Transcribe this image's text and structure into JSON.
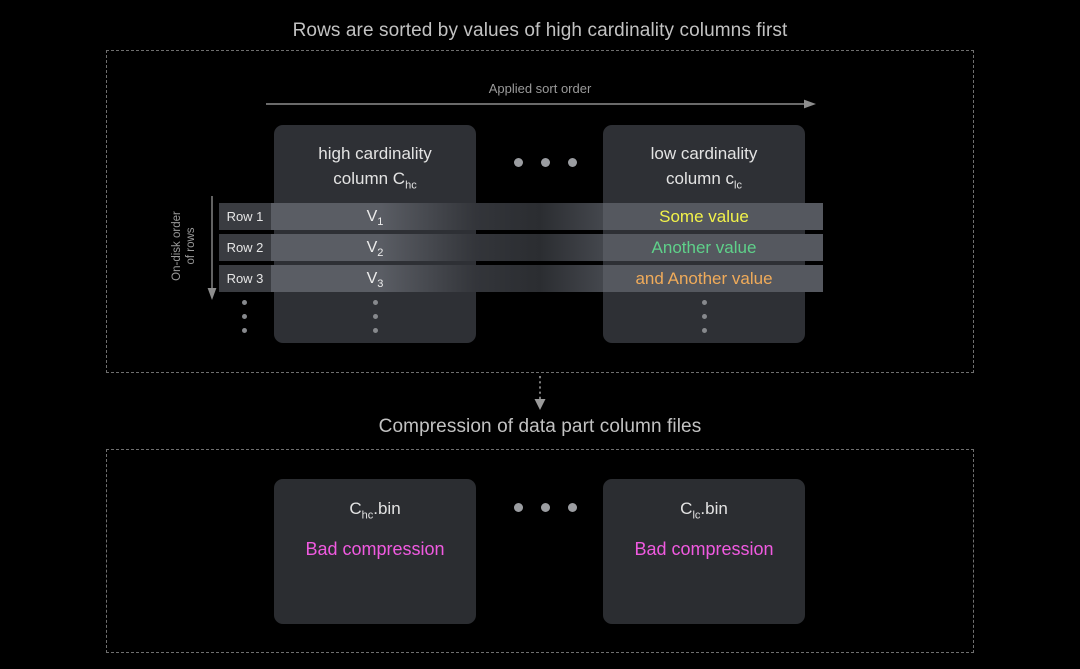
{
  "titles": {
    "top": "Rows are sorted by values of high cardinality columns first",
    "middle": "Compression of data part column files"
  },
  "sort_order": {
    "label": "Applied sort order",
    "direction": "left-to-right"
  },
  "on_disk_order": {
    "label": "On-disk order\nof rows",
    "direction": "top-to-bottom"
  },
  "columns": [
    {
      "id": "hc",
      "head_line1": "high cardinality",
      "head_line2": "column C",
      "head_sub": "hc"
    },
    {
      "id": "lc",
      "head_line1": "low cardinality",
      "head_line2": "column c",
      "head_sub": "lc"
    }
  ],
  "rows": [
    {
      "label": "Row 1",
      "hc_value": "V",
      "hc_sub": "1",
      "lc_value": "Some value",
      "lc_color": "#f3f34a"
    },
    {
      "label": "Row 2",
      "hc_value": "V",
      "hc_sub": "2",
      "lc_value": "Another value",
      "lc_color": "#5fd18a"
    },
    {
      "label": "Row 3",
      "hc_value": "V",
      "hc_sub": "3",
      "lc_value": "and Another value",
      "lc_color": "#f0ab5a"
    }
  ],
  "ellipsis": {
    "horizontal_dots": 3,
    "vertical_dots": 3
  },
  "files": [
    {
      "id": "hc",
      "name": "C",
      "sub": "hc",
      "ext": ".bin",
      "note": "Bad compression",
      "note_color": "#f05ae0"
    },
    {
      "id": "lc",
      "name": "C",
      "sub": "lc",
      "ext": ".bin",
      "note": "Bad compression",
      "note_color": "#f05ae0"
    }
  ],
  "colors": {
    "background": "#000000",
    "panel_border": "#6f6f6f",
    "box_fill": "#2e3035",
    "file_box_fill": "#2b2d31",
    "row_band": "#55585f",
    "row_label_fill": "#3a3c41",
    "title_text": "#c2c2c2",
    "muted_text": "#9a9a9a",
    "arrow": "#8d8d8d"
  }
}
